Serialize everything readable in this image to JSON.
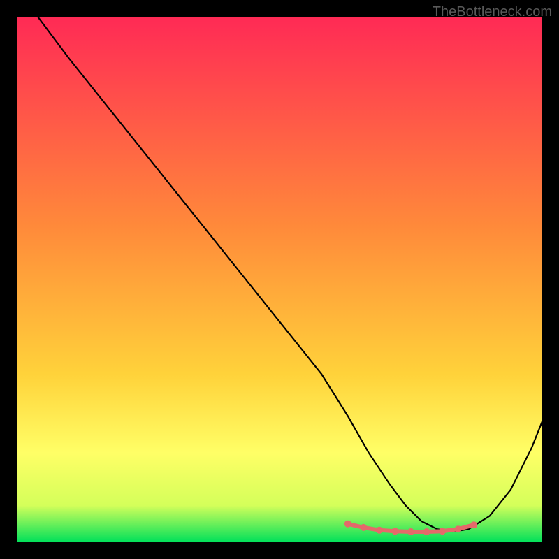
{
  "watermark": "TheBottleneck.com",
  "colors": {
    "background": "#000000",
    "gradient_top": "#ff2a55",
    "gradient_mid": "#ffd23a",
    "gradient_low": "#ffff66",
    "gradient_bottom": "#00e05a",
    "curve": "#000000",
    "marker": "#e46a6a"
  },
  "chart_data": {
    "type": "line",
    "title": "",
    "xlabel": "",
    "ylabel": "",
    "xlim": [
      0,
      100
    ],
    "ylim": [
      0,
      100
    ],
    "series": [
      {
        "name": "bottleneck-curve",
        "x": [
          4,
          10,
          18,
          26,
          34,
          42,
          50,
          58,
          63,
          67,
          71,
          74,
          77,
          80,
          83,
          86,
          90,
          94,
          98,
          100
        ],
        "y": [
          100,
          92,
          82,
          72,
          62,
          52,
          42,
          32,
          24,
          17,
          11,
          7,
          4,
          2.5,
          2,
          2.5,
          5,
          10,
          18,
          23
        ]
      },
      {
        "name": "optimal-zone-markers",
        "x": [
          63,
          66,
          69,
          72,
          75,
          78,
          81,
          84,
          87
        ],
        "y": [
          3.5,
          2.8,
          2.3,
          2.1,
          2.0,
          2.0,
          2.1,
          2.5,
          3.3
        ]
      }
    ],
    "gradient_stops": [
      {
        "offset": 0.0,
        "color": "#ff2a55"
      },
      {
        "offset": 0.4,
        "color": "#ff8a3a"
      },
      {
        "offset": 0.68,
        "color": "#ffd23a"
      },
      {
        "offset": 0.83,
        "color": "#ffff66"
      },
      {
        "offset": 0.93,
        "color": "#d4ff5a"
      },
      {
        "offset": 1.0,
        "color": "#00e05a"
      }
    ]
  }
}
